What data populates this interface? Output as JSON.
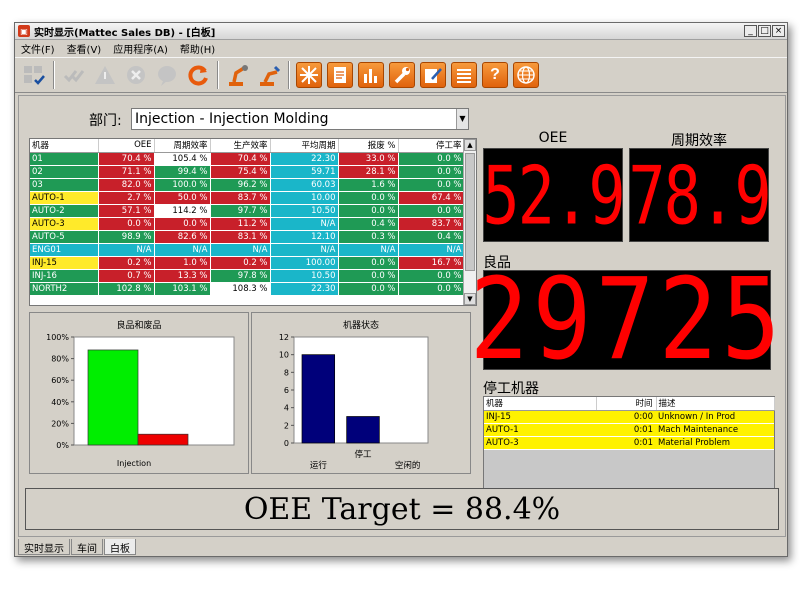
{
  "window": {
    "title": "实时显示(Mattec Sales DB) - [白板]",
    "controls": [
      "_",
      "□",
      "×"
    ]
  },
  "menu": [
    "文件(F)",
    "查看(V)",
    "应用程序(A)",
    "帮助(H)"
  ],
  "toolbar": {
    "buttons": [
      {
        "name": "layout-icon",
        "style": "gray"
      },
      {
        "name": "check-icon",
        "style": "gray"
      },
      {
        "name": "warning-icon",
        "style": "gray"
      },
      {
        "name": "cancel-icon",
        "style": "gray"
      },
      {
        "name": "help-bubble-icon",
        "style": "gray"
      },
      {
        "name": "refresh-icon",
        "style": "plain"
      },
      {
        "name": "robot-arm-icon",
        "style": "plain"
      },
      {
        "name": "robot-arm-alt-icon",
        "style": "plain"
      },
      {
        "name": "burst-icon",
        "style": "orange"
      },
      {
        "name": "document-icon",
        "style": "orange"
      },
      {
        "name": "bar-chart-icon",
        "style": "orange"
      },
      {
        "name": "wrench-icon",
        "style": "orange"
      },
      {
        "name": "edit-icon",
        "style": "orange"
      },
      {
        "name": "list-icon",
        "style": "orange"
      },
      {
        "name": "question-icon",
        "style": "orange"
      },
      {
        "name": "globe-icon",
        "style": "orange"
      }
    ],
    "question_glyph": "?"
  },
  "department": {
    "label": "部门:",
    "value": "Injection - Injection Molding"
  },
  "grid": {
    "columns": [
      "机器",
      "OEE",
      "周期效率",
      "生产效率",
      "平均周期",
      "报废 %",
      "停工率"
    ],
    "rows": [
      {
        "cells": [
          "01",
          "70.4 %",
          "105.4 %",
          "70.4 %",
          "22.30",
          "33.0 %",
          "0.0 %"
        ],
        "colors": [
          "green",
          "red",
          "white",
          "red",
          "cyan",
          "red",
          "green"
        ]
      },
      {
        "cells": [
          "02",
          "71.1 %",
          "99.4 %",
          "75.4 %",
          "59.71",
          "28.1 %",
          "0.0 %"
        ],
        "colors": [
          "green",
          "red",
          "green",
          "red",
          "cyan",
          "red",
          "green"
        ]
      },
      {
        "cells": [
          "03",
          "82.0 %",
          "100.0 %",
          "96.2 %",
          "60.03",
          "1.6 %",
          "0.0 %"
        ],
        "colors": [
          "green",
          "red",
          "green",
          "green",
          "cyan",
          "green",
          "green"
        ]
      },
      {
        "cells": [
          "AUTO-1",
          "2.7 %",
          "50.0 %",
          "83.7 %",
          "10.00",
          "0.0 %",
          "67.4 %"
        ],
        "colors": [
          "yellow",
          "red",
          "red",
          "red",
          "cyan",
          "green",
          "red"
        ]
      },
      {
        "cells": [
          "AUTO-2",
          "57.1 %",
          "114.2 %",
          "97.7 %",
          "10.50",
          "0.0 %",
          "0.0 %"
        ],
        "colors": [
          "green",
          "red",
          "white",
          "green",
          "cyan",
          "green",
          "green"
        ]
      },
      {
        "cells": [
          "AUTO-3",
          "0.0 %",
          "0.0 %",
          "11.2 %",
          "N/A",
          "0.4 %",
          "83.7 %"
        ],
        "colors": [
          "yellow",
          "red",
          "red",
          "red",
          "cyan",
          "green",
          "red"
        ]
      },
      {
        "cells": [
          "AUTO-5",
          "98.9 %",
          "82.6 %",
          "83.1 %",
          "12.10",
          "0.3 %",
          "0.4 %"
        ],
        "colors": [
          "green",
          "green",
          "red",
          "red",
          "cyan",
          "green",
          "green"
        ]
      },
      {
        "cells": [
          "ENG01",
          "N/A",
          "N/A",
          "N/A",
          "N/A",
          "N/A",
          "N/A"
        ],
        "colors": [
          "teal",
          "teal",
          "teal",
          "teal",
          "teal",
          "teal",
          "teal"
        ]
      },
      {
        "cells": [
          "INJ-15",
          "0.2 %",
          "1.0 %",
          "0.2 %",
          "100.00",
          "0.0 %",
          "16.7 %"
        ],
        "colors": [
          "yellow",
          "red",
          "red",
          "red",
          "cyan",
          "green",
          "red"
        ]
      },
      {
        "cells": [
          "INJ-16",
          "0.7 %",
          "13.3 %",
          "97.8 %",
          "10.50",
          "0.0 %",
          "0.0 %"
        ],
        "colors": [
          "green",
          "red",
          "red",
          "green",
          "cyan",
          "green",
          "green"
        ]
      },
      {
        "cells": [
          "NORTH2",
          "102.8 %",
          "103.1 %",
          "108.3 %",
          "22.30",
          "0.0 %",
          "0.0 %"
        ],
        "colors": [
          "green",
          "green",
          "green",
          "white",
          "cyan",
          "green",
          "green"
        ]
      }
    ]
  },
  "scrollbar": {
    "up": "▲",
    "down": "▼"
  },
  "select_arrow": "▼",
  "gauges": {
    "oee_label": "OEE",
    "oee_value": "52.9",
    "cycle_label": "周期效率",
    "cycle_value": "78.9",
    "good_label": "良品",
    "good_value": "29725"
  },
  "chart_data": [
    {
      "type": "bar",
      "title": "良品和废品",
      "categories": [
        "Injection"
      ],
      "series": [
        {
          "values": [
            88
          ],
          "color": "#00ee00"
        },
        {
          "values": [
            10
          ],
          "color": "#ee0000"
        }
      ],
      "ylim": [
        0,
        100
      ],
      "ytick_labels": [
        "0%",
        "20%",
        "40%",
        "60%",
        "80%",
        "100%"
      ]
    },
    {
      "type": "bar",
      "title": "机器状态",
      "categories": [
        "运行",
        "停工",
        "空闲的"
      ],
      "values": [
        10,
        3,
        0
      ],
      "color": "#00007a",
      "ylim": [
        0,
        12
      ],
      "ytick_labels": [
        "0",
        "2",
        "4",
        "6",
        "8",
        "10",
        "12"
      ]
    }
  ],
  "downtime": {
    "title": "停工机器",
    "columns": [
      "机器",
      "时间",
      "描述"
    ],
    "rows": [
      [
        "INJ-15",
        "0:00",
        "Unknown / In Prod"
      ],
      [
        "AUTO-1",
        "0:01",
        "Mach Maintenance"
      ],
      [
        "AUTO-3",
        "0:01",
        "Material Problem"
      ]
    ]
  },
  "target": {
    "text": "OEE Target = 88.4%"
  },
  "tabs": [
    {
      "label": "实时显示",
      "active": false
    },
    {
      "label": "车间",
      "active": false
    },
    {
      "label": "白板",
      "active": true
    }
  ]
}
